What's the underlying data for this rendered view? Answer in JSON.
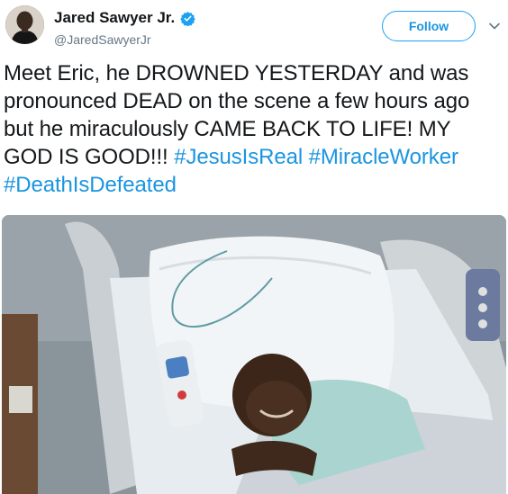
{
  "author": {
    "display_name": "Jared Sawyer Jr.",
    "handle": "@JaredSawyerJr",
    "verified": true,
    "avatar": "profile-photo"
  },
  "actions": {
    "follow_label": "Follow",
    "menu_icon": "chevron-down-icon"
  },
  "tweet": {
    "text_plain": "Meet Eric, he DROWNED YESTERDAY and was pronounced DEAD on the scene a few hours ago but he miraculously CAME BACK TO LIFE! MY GOD IS GOOD!!!",
    "hashtags": [
      "#JesusIsReal",
      "#MiracleWorker",
      "#DeathIsDefeated"
    ]
  },
  "media": {
    "type": "photo",
    "subject": "child-in-hospital-bed"
  },
  "colors": {
    "accent": "#1da1f2",
    "link": "#1b95e0",
    "text": "#14171a",
    "muted": "#657786"
  }
}
